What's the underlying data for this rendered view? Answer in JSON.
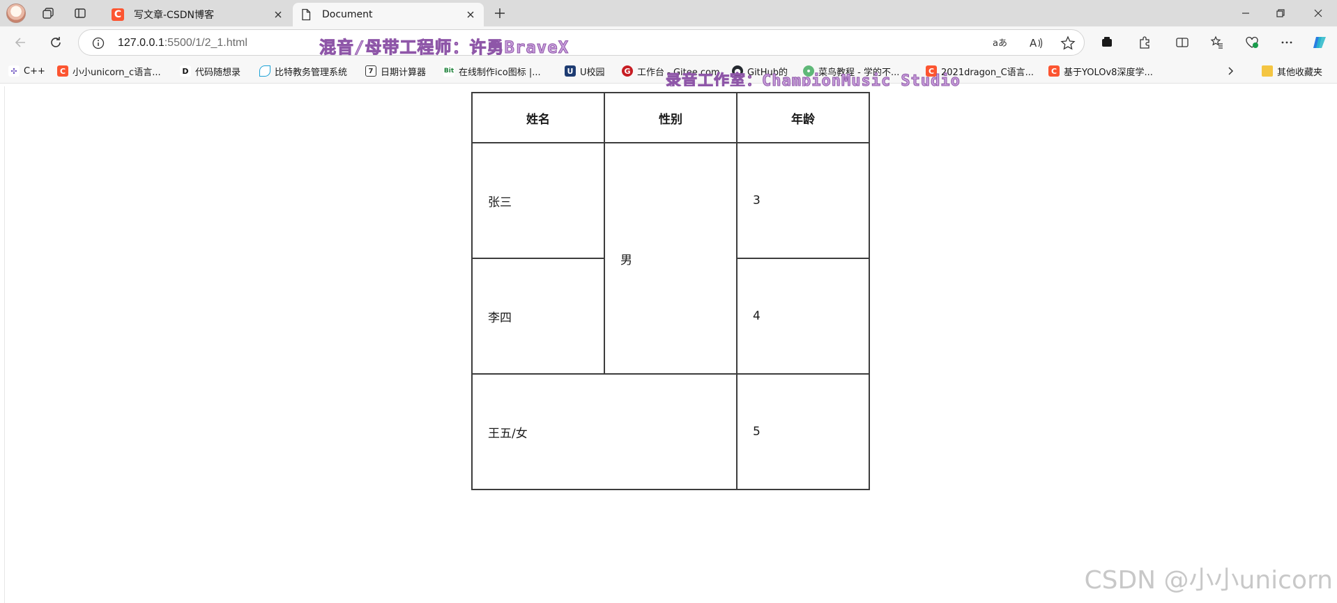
{
  "browser": {
    "tabs": [
      {
        "title": "写文章-CSDN博客",
        "favicon": "csdn-icon",
        "active": false
      },
      {
        "title": "Document",
        "favicon": "page-icon",
        "active": true
      }
    ],
    "url": {
      "host": "127.0.0.1",
      "path": ":5500/1/2_1.html"
    },
    "bookmarks": [
      {
        "label": "C++",
        "icon": "cpp-icon"
      },
      {
        "label": "小小unicorn_c语言...",
        "icon": "csdn-icon"
      },
      {
        "label": "代码随想录",
        "icon": "dd-icon"
      },
      {
        "label": "比特教务管理系统",
        "icon": "leaf-icon"
      },
      {
        "label": "日期计算器",
        "icon": "date-icon"
      },
      {
        "label": "在线制作ico图标 |...",
        "icon": "bit-icon"
      },
      {
        "label": "U校园",
        "icon": "u-icon"
      },
      {
        "label": "工作台 - Gitee.com",
        "icon": "gitee-icon"
      },
      {
        "label": "GitHub的",
        "icon": "github-icon"
      },
      {
        "label": "菜鸟教程 - 学的不...",
        "icon": "runoob-icon"
      },
      {
        "label": "2021dragon_C语言...",
        "icon": "csdn-icon"
      },
      {
        "label": "基于YOLOv8深度学...",
        "icon": "csdn-icon"
      }
    ],
    "other_bookmarks": "其他收藏夹"
  },
  "overlays": {
    "watermark_line1": "混音/母带工程师：许勇BraveX",
    "watermark_line2": "录音工作室：ChampionMusic Studio",
    "csdn_watermark": "CSDN @小小unicorn"
  },
  "table": {
    "headers": [
      "姓名",
      "性别",
      "年龄"
    ],
    "rows": [
      {
        "name": "张三",
        "gender": "男",
        "age": "3"
      },
      {
        "name": "李四",
        "age": "4"
      },
      {
        "name_gender": "王五/女",
        "age": "5"
      }
    ]
  }
}
